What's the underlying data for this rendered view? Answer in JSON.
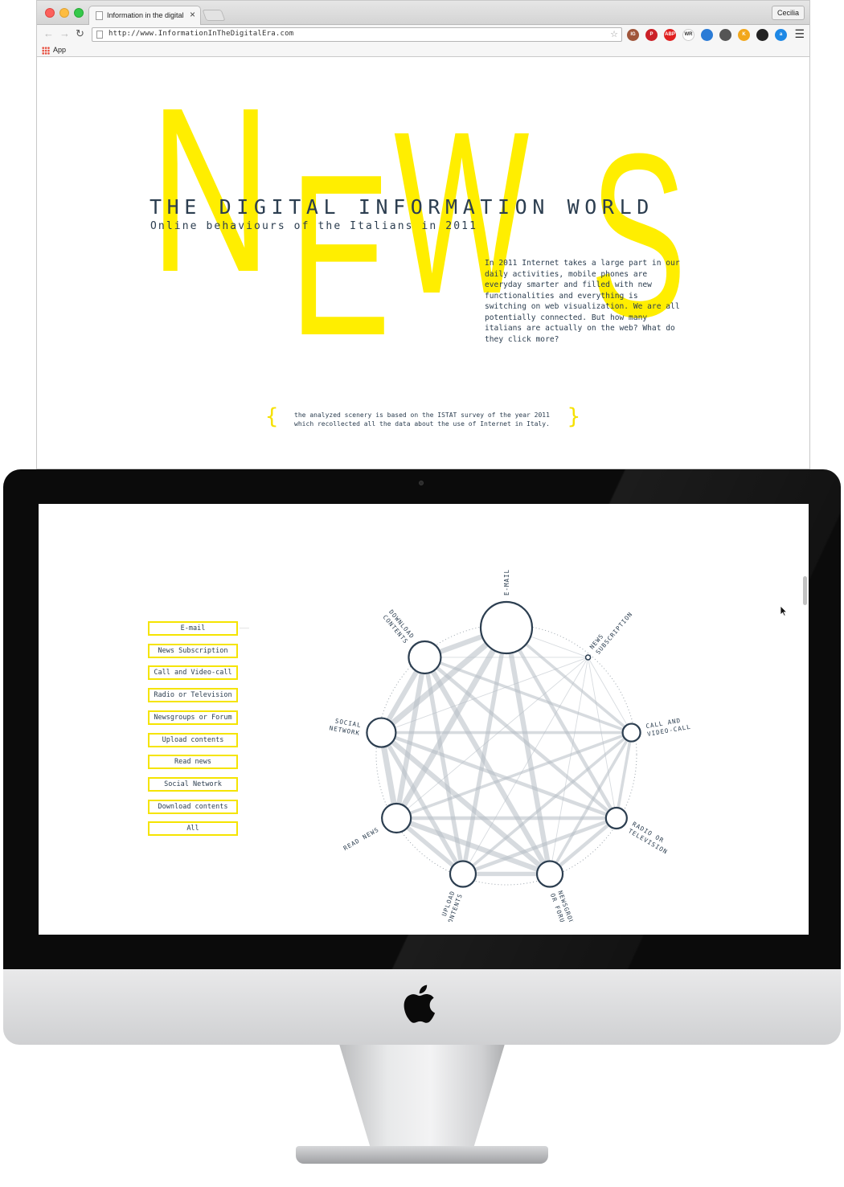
{
  "browser": {
    "tab_title": "Information in the digital era",
    "tab_close": "×",
    "profile_name": "Cecilia",
    "url": "http://www.InformationInTheDigitalEra.com",
    "nav_back": "←",
    "nav_forward": "→",
    "nav_reload": "↻",
    "bookmark_apps_label": "App",
    "extensions": [
      {
        "label": "IG",
        "color": "#a0553a"
      },
      {
        "label": "P",
        "color": "#cb2027"
      },
      {
        "label": "ABP",
        "color": "#e02020"
      },
      {
        "label": "WR",
        "color": "#ffffff"
      },
      {
        "label": "",
        "color": "#2a7bd6"
      },
      {
        "label": "",
        "color": "#555555"
      },
      {
        "label": "K",
        "color": "#f2a71b"
      },
      {
        "label": "",
        "color": "#222222"
      },
      {
        "label": "a",
        "color": "#1e88e5"
      }
    ]
  },
  "hero": {
    "letters": [
      "N",
      "E",
      "W",
      "S"
    ],
    "title": "THE DIGITAL INFORMATION WORLD",
    "subtitle": "Online behaviours of the Italians in 2011",
    "intro": "In 2011 Internet takes a large part in our daily activities, mobile phones are everyday smarter and filled with new functionalities and everything is switching on web visualization. We are all potentially connected. But how many italians are actually on the web? What do they click more?",
    "note_line1": "the analyzed scenery is based on the ISTAT survey of the year 2011",
    "note_line2": "which recollected all the data about the use of Internet in Italy.",
    "brace_open": "{",
    "brace_close": "}",
    "accent_color": "#ffee00"
  },
  "filters": [
    "E-mail",
    "News Subscription",
    "Call and Video-call",
    "Radio or Television",
    "Newsgroups or Forum",
    "Upload contents",
    "Read news",
    "Social Network",
    "Download contents",
    "All"
  ],
  "network": {
    "nodes": [
      {
        "id": "email",
        "label_lines": [
          "E-MAIL"
        ]
      },
      {
        "id": "news_sub",
        "label_lines": [
          "NEWS",
          "SUBSCRIPTION"
        ]
      },
      {
        "id": "call",
        "label_lines": [
          "CALL AND",
          "VIDEO-CALL"
        ]
      },
      {
        "id": "radio",
        "label_lines": [
          "RADIO OR",
          "TELEVISION"
        ]
      },
      {
        "id": "newsgroups",
        "label_lines": [
          "NEWSGROUPS",
          "OR FORUM"
        ]
      },
      {
        "id": "upload",
        "label_lines": [
          "UPLOAD",
          "CONTENTS"
        ]
      },
      {
        "id": "read",
        "label_lines": [
          "READ NEWS"
        ]
      },
      {
        "id": "social",
        "label_lines": [
          "SOCIAL",
          "NETWORK"
        ]
      },
      {
        "id": "download",
        "label_lines": [
          "DOWNLOAD",
          "CONTENTS"
        ]
      }
    ],
    "node_color": "#2c3e50",
    "link_color": "#b7bec4"
  }
}
